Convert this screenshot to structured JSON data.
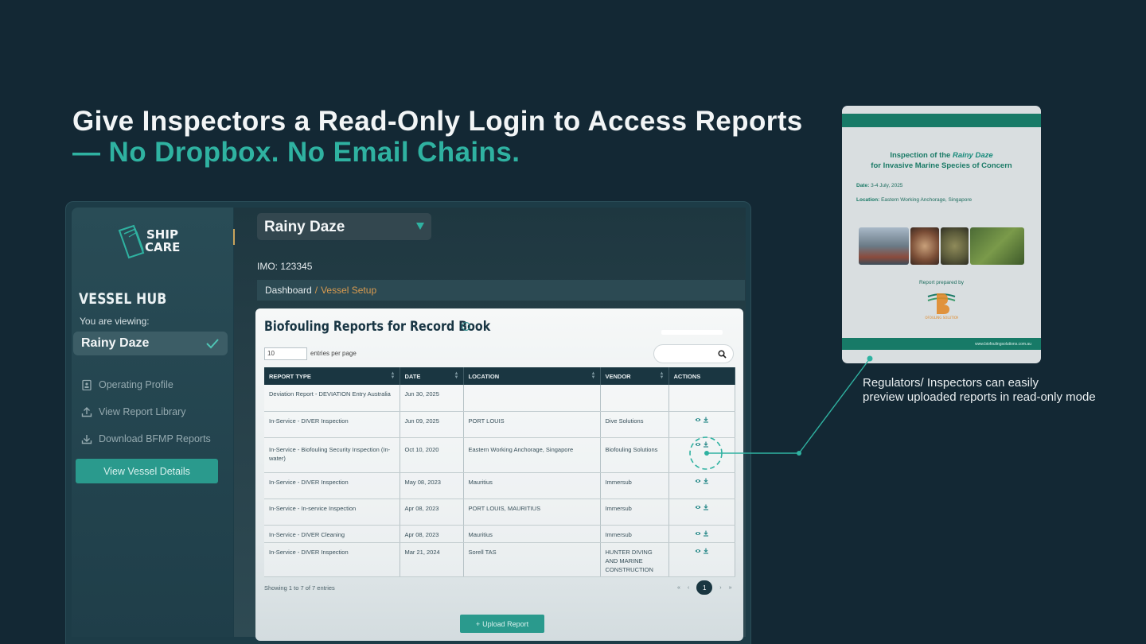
{
  "headline": {
    "line1": "Give Inspectors a Read-Only Login to Access Reports",
    "line2": "— No Dropbox. No Email Chains."
  },
  "sidebar": {
    "section_title": "VESSEL HUB",
    "viewing_label": "You are viewing:",
    "current_vessel": "Rainy Daze",
    "items": [
      {
        "label": "Operating Profile",
        "icon": "clipboard-icon"
      },
      {
        "label": "View Report Library",
        "icon": "upload-icon"
      },
      {
        "label": "Download BFMP Reports",
        "icon": "download-icon"
      }
    ],
    "details_button": "View Vessel Details"
  },
  "header": {
    "vessel_select": "Rainy Daze",
    "imo": "IMO: 123345",
    "breadcrumb": {
      "home": "Dashboard",
      "separator": "/",
      "current": "Vessel Setup"
    }
  },
  "card": {
    "title": "Biofouling Reports for Record Book",
    "entries_value": "10",
    "entries_label": "entries per page",
    "columns": [
      "REPORT TYPE",
      "DATE",
      "LOCATION",
      "VENDOR",
      "ACTIONS"
    ],
    "rows": [
      {
        "type": "Deviation Report - DEVIATION Entry Australia",
        "date": "Jun 30, 2025",
        "location": "",
        "vendor": "",
        "actions": false
      },
      {
        "type": "In-Service - DIVER Inspection",
        "date": "Jun 09, 2025",
        "location": "PORT LOUIS",
        "vendor": "Dive Solutions",
        "actions": true
      },
      {
        "type": "In-Service - Biofouling Security Inspection (In-water)",
        "date": "Oct 10, 2020",
        "location": "Eastern Working Anchorage, Singapore",
        "vendor": "Biofouling Solutions",
        "actions": true
      },
      {
        "type": "In-Service - DIVER Inspection",
        "date": "May 08, 2023",
        "location": "Mauritius",
        "vendor": "Immersub",
        "actions": true
      },
      {
        "type": "In-Service - In-service Inspection",
        "date": "Apr 08, 2023",
        "location": "PORT LOUIS, MAURITIUS",
        "vendor": "Immersub",
        "actions": true
      },
      {
        "type": "In-Service - DIVER Cleaning",
        "date": "Apr 08, 2023",
        "location": "Mauritius",
        "vendor": "Immersub",
        "actions": true
      },
      {
        "type": "In-Service - DIVER Inspection",
        "date": "Mar 21, 2024",
        "location": "Sorell TAS",
        "vendor": "HUNTER DIVING AND MARINE CONSTRUCTION",
        "actions": true
      }
    ],
    "showing": "Showing 1 to 7 of 7 entries",
    "pagination": {
      "first": "«",
      "prev": "‹",
      "current": "1",
      "next": "›",
      "last": "»"
    },
    "upload_button": "Upload Report"
  },
  "preview": {
    "title_prefix": "Inspection of the",
    "vessel": "Rainy Daze",
    "title_line2": "for Invasive Marine Species of Concern",
    "date_label": "Date:",
    "date_value": "3-4 July, 2025",
    "location_label": "Location:",
    "location_value": "Eastern Working Anchorage, Singapore",
    "prepared_by": "Report prepared by",
    "company": "BIOFOULING SOLUTIONS",
    "url": "www.biofoulingsolutions.com.au"
  },
  "callout": {
    "line1": "Regulators/ Inspectors can easily",
    "line2": "preview uploaded reports in read-only mode"
  },
  "colors": {
    "background": "#132834",
    "accent": "#2fb2a1",
    "breadcrumb_accent": "#d99b50",
    "table_header": "#1a3641"
  }
}
